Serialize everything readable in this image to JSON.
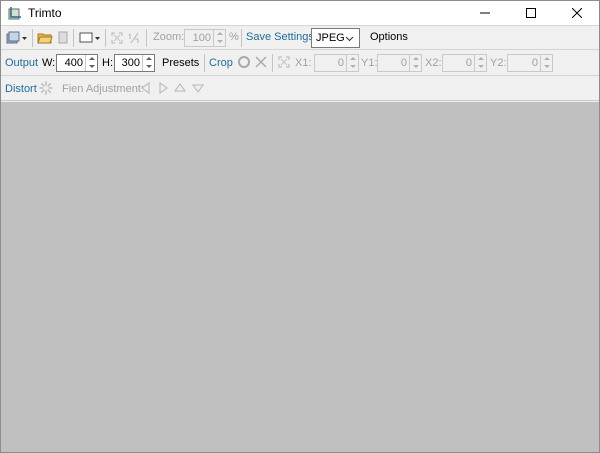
{
  "window": {
    "title": "Trimto"
  },
  "toolbar1": {
    "zoom_label": "Zoom:",
    "zoom_value": "100",
    "zoom_unit": "%",
    "save_settings_label": "Save Settings",
    "format_selected": "JPEG",
    "options_label": "Options"
  },
  "toolbar2": {
    "output_label": "Output",
    "w_label": "W:",
    "w_value": "400",
    "h_label": "H:",
    "h_value": "300",
    "presets_label": "Presets",
    "crop_label": "Crop",
    "x1_label": "X1:",
    "x1_value": "0",
    "y1_label": "Y1:",
    "y1_value": "0",
    "x2_label": "X2:",
    "x2_value": "0",
    "y2_label": "Y2:",
    "y2_value": "0"
  },
  "toolbar3": {
    "distort_label": "Distort",
    "fine_adjust_label": "Fien Adjustment:"
  },
  "colors": {
    "section_label": "#1f6b9b",
    "canvas_bg": "#c0c0c0",
    "toolbar_bg": "#f0f0f0",
    "disabled_text": "#a0a0a0"
  }
}
